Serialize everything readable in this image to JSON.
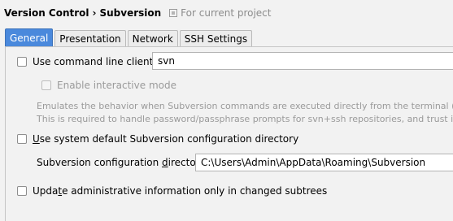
{
  "breadcrumb": {
    "parent": "Version Control",
    "separator": "›",
    "current": "Subversion",
    "scope": "For current project"
  },
  "tabs": [
    {
      "label": "General",
      "active": true
    },
    {
      "label": "Presentation",
      "active": false
    },
    {
      "label": "Network",
      "active": false
    },
    {
      "label": "SSH Settings",
      "active": false
    }
  ],
  "general": {
    "use_cmd_client": {
      "label": "Use command line client:",
      "checked": false,
      "value": "svn"
    },
    "interactive_mode": {
      "label": "Enable interactive mode",
      "checked": false,
      "enabled": false
    },
    "description_line1": "Emulates the behavior when Subversion commands are executed directly from the terminal (in th",
    "description_line2": "This is required to handle password/passphrase prompts for svn+ssh repositories, and trust invali",
    "use_default_config": {
      "label_prefix": "U",
      "label_rest": "se system default Subversion configuration directory",
      "checked": false
    },
    "config_dir": {
      "label_prefix": "Subversion configuration ",
      "label_mnemonic": "d",
      "label_rest": "irectory:",
      "value": "C:\\Users\\Admin\\AppData\\Roaming\\Subversion"
    },
    "update_admin": {
      "label_prefix": "Upda",
      "label_mnemonic": "t",
      "label_rest": "e administrative information only in changed subtrees",
      "checked": false
    }
  },
  "colors": {
    "active_tab": "#4a89dc",
    "background": "#f2f2f2",
    "disabled_text": "#9a9a9a"
  }
}
